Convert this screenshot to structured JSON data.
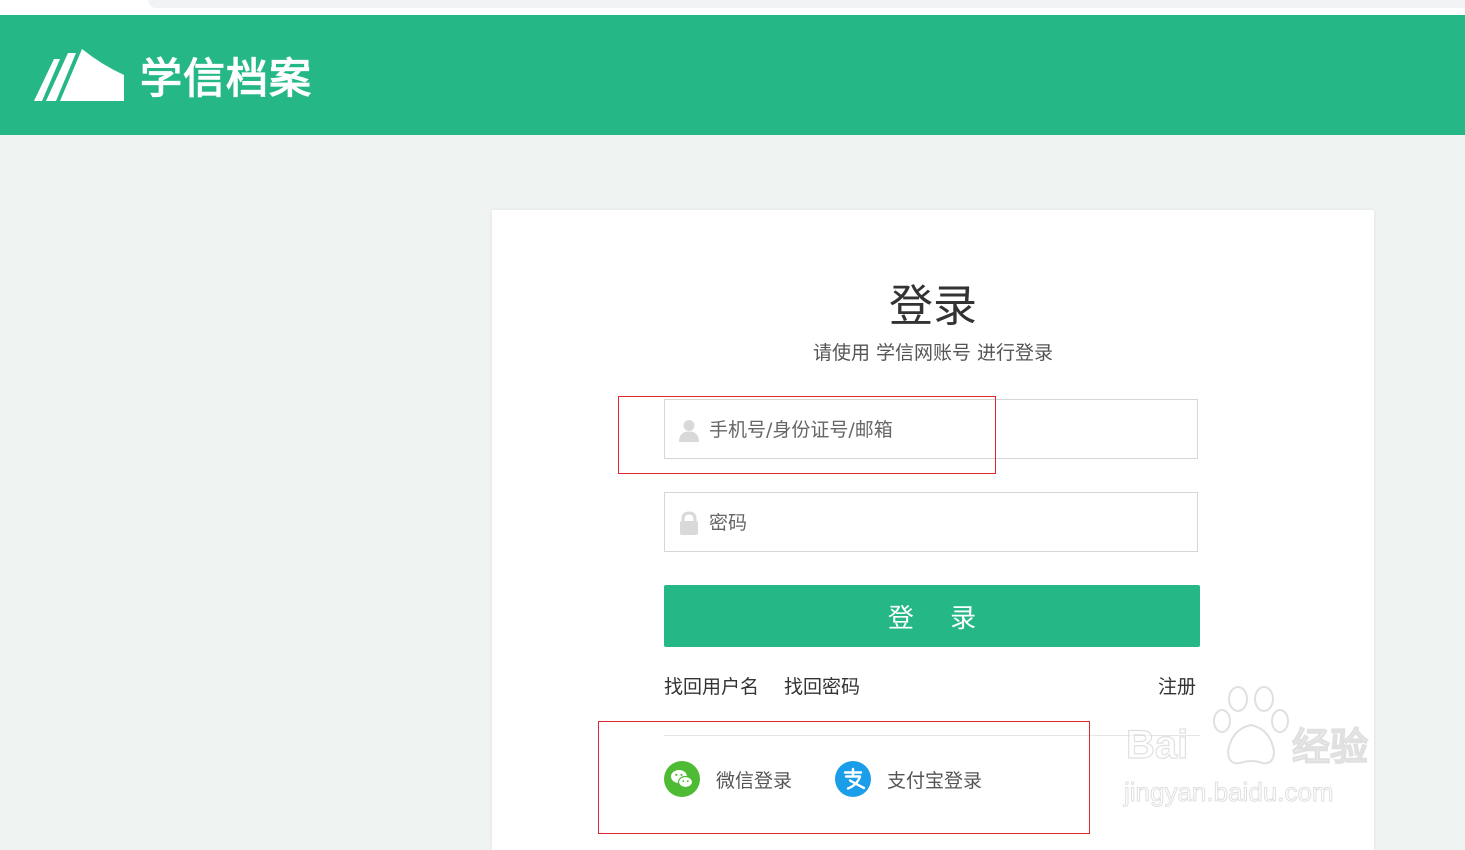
{
  "header": {
    "brand_name": "学信档案",
    "bg_color": "#25b886",
    "logo_icon": "book-pages-logo"
  },
  "login": {
    "title": "登录",
    "subtitle": "请使用 学信网账号 进行登录",
    "username_placeholder": "手机号/身份证号/邮箱",
    "username_icon": "user-icon",
    "password_placeholder": "密码",
    "password_icon": "lock-icon",
    "submit_label": "登 录",
    "accent_color": "#25b886"
  },
  "links": {
    "find_username": "找回用户名",
    "find_password": "找回密码",
    "register": "注册"
  },
  "third_party": [
    {
      "label": "微信登录",
      "icon": "wechat-icon",
      "color": "#4dbb33"
    },
    {
      "label": "支付宝登录",
      "icon": "alipay-icon",
      "color": "#1a9eea"
    }
  ],
  "annotations": {
    "highlight_color": "#e0262e"
  },
  "watermark": {
    "line1": "Bai",
    "line1_cn": "经验",
    "line2": "jingyan.baidu.com"
  }
}
